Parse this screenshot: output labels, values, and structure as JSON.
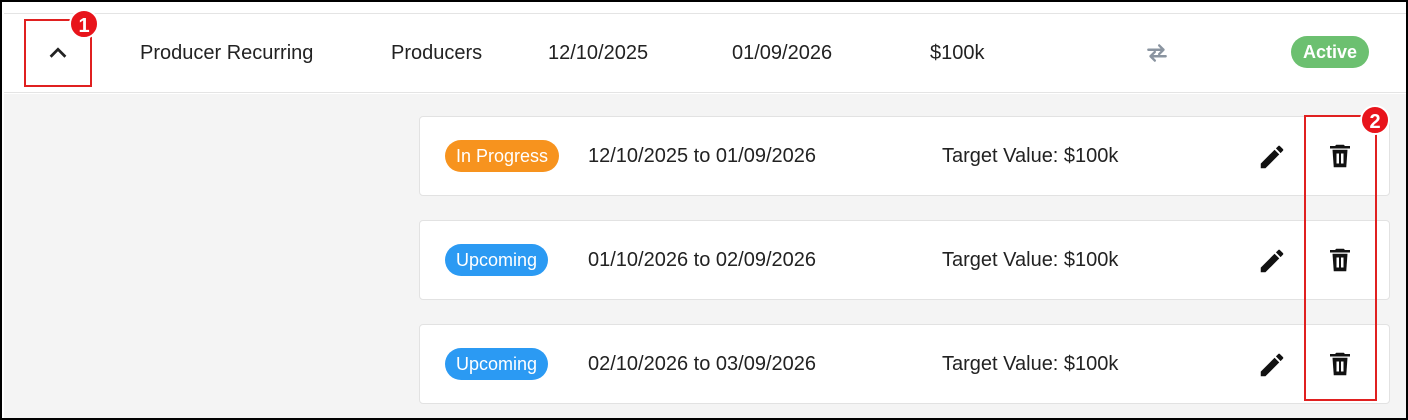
{
  "header_row": {
    "name": "Producer Recurring",
    "group": "Producers",
    "start_date": "12/10/2025",
    "end_date": "01/09/2026",
    "target": "$100k",
    "recurring_icon": "repeat-icon",
    "status": "Active",
    "status_color": "#6cc070",
    "toggle_icon": "chevron-up-icon"
  },
  "periods": [
    {
      "status": "In Progress",
      "status_color": "#f7931e",
      "range": "12/10/2025 to 01/09/2026",
      "target": "Target Value: $100k"
    },
    {
      "status": "Upcoming",
      "status_color": "#2b9af3",
      "range": "01/10/2026 to 02/09/2026",
      "target": "Target Value: $100k"
    },
    {
      "status": "Upcoming",
      "status_color": "#2b9af3",
      "range": "02/10/2026 to 03/09/2026",
      "target": "Target Value: $100k"
    }
  ],
  "row_action_icons": [
    "pencil-icon",
    "trash-icon"
  ],
  "annotations": {
    "marker_1": "1",
    "marker_2": "2",
    "highlight_color": "#e02020"
  }
}
